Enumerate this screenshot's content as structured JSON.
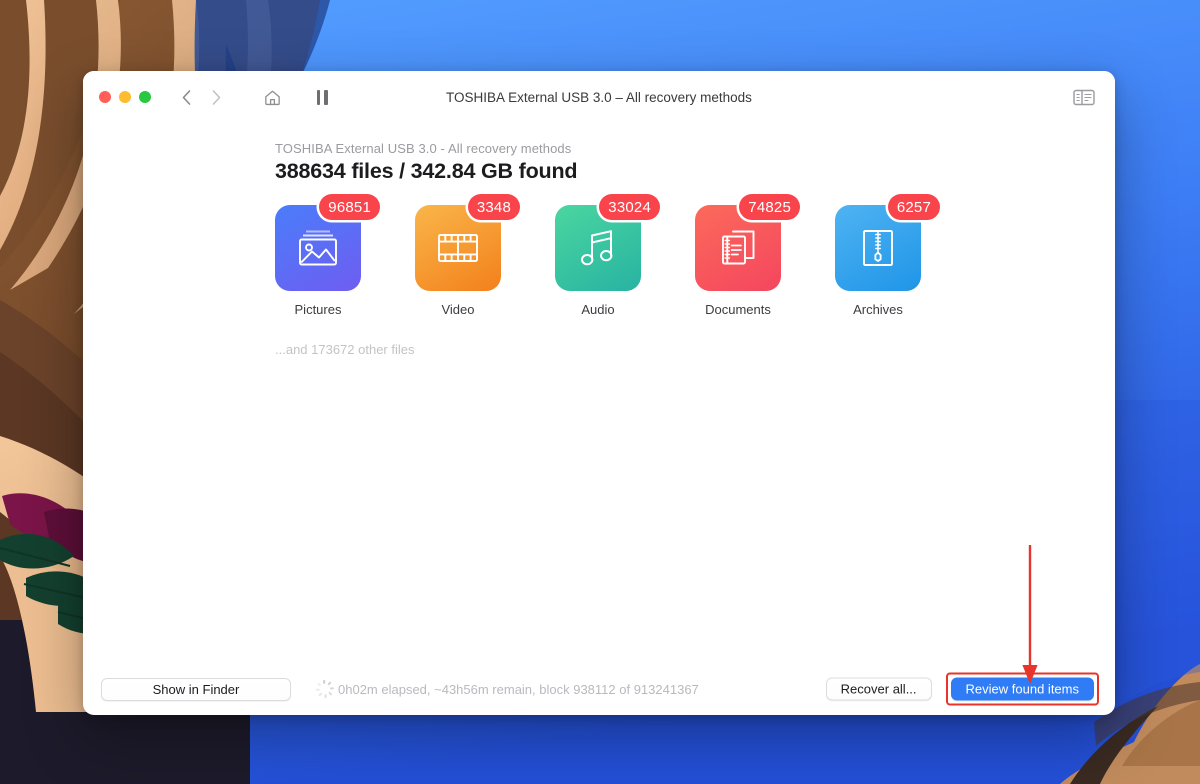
{
  "window": {
    "title": "TOSHIBA External USB 3.0 – All recovery methods",
    "traffic_lights": [
      "close",
      "minimize",
      "zoom"
    ],
    "toolbar": {
      "back_icon": "chevron-left-icon",
      "forward_icon": "chevron-right-icon",
      "home_icon": "home-icon",
      "pause_icon": "pause-icon",
      "sidebar_toggle_icon": "sidebar-toggle-icon"
    }
  },
  "main": {
    "subheading": "TOSHIBA External USB 3.0 - All recovery methods",
    "heading": "388634 files / 342.84 GB found",
    "other_files": "...and 173672 other files",
    "categories": [
      {
        "label": "Pictures",
        "count": "96851",
        "icon": "picture-icon",
        "color_from": "#4a7dfb",
        "color_to": "#6f5df0"
      },
      {
        "label": "Video",
        "count": "3348",
        "icon": "film-icon",
        "color_from": "#f9b64a",
        "color_to": "#f3801b"
      },
      {
        "label": "Audio",
        "count": "33024",
        "icon": "music-note-icon",
        "color_from": "#4bd6a0",
        "color_to": "#27b3a2"
      },
      {
        "label": "Documents",
        "count": "74825",
        "icon": "documents-icon",
        "color_from": "#fc6a5a",
        "color_to": "#f4465f"
      },
      {
        "label": "Archives",
        "count": "6257",
        "icon": "zip-archive-icon",
        "color_from": "#4fb3f2",
        "color_to": "#1f95e8"
      }
    ]
  },
  "bottom_bar": {
    "show_in_finder_label": "Show in Finder",
    "status_icon": "spinner-icon",
    "status_text": "0h02m elapsed, ~43h56m remain, block 938112 of 913241367",
    "recover_all_label": "Recover all...",
    "review_found_items_label": "Review found items"
  },
  "annotation": {
    "arrow_icon": "down-arrow-annotation",
    "arrow_color": "#e8342b",
    "highlight_color": "#e8342b"
  },
  "colors": {
    "badge_red": "#f9444b",
    "primary_blue": "#2f7cf6",
    "desktop_blue": "#2f63e8"
  }
}
